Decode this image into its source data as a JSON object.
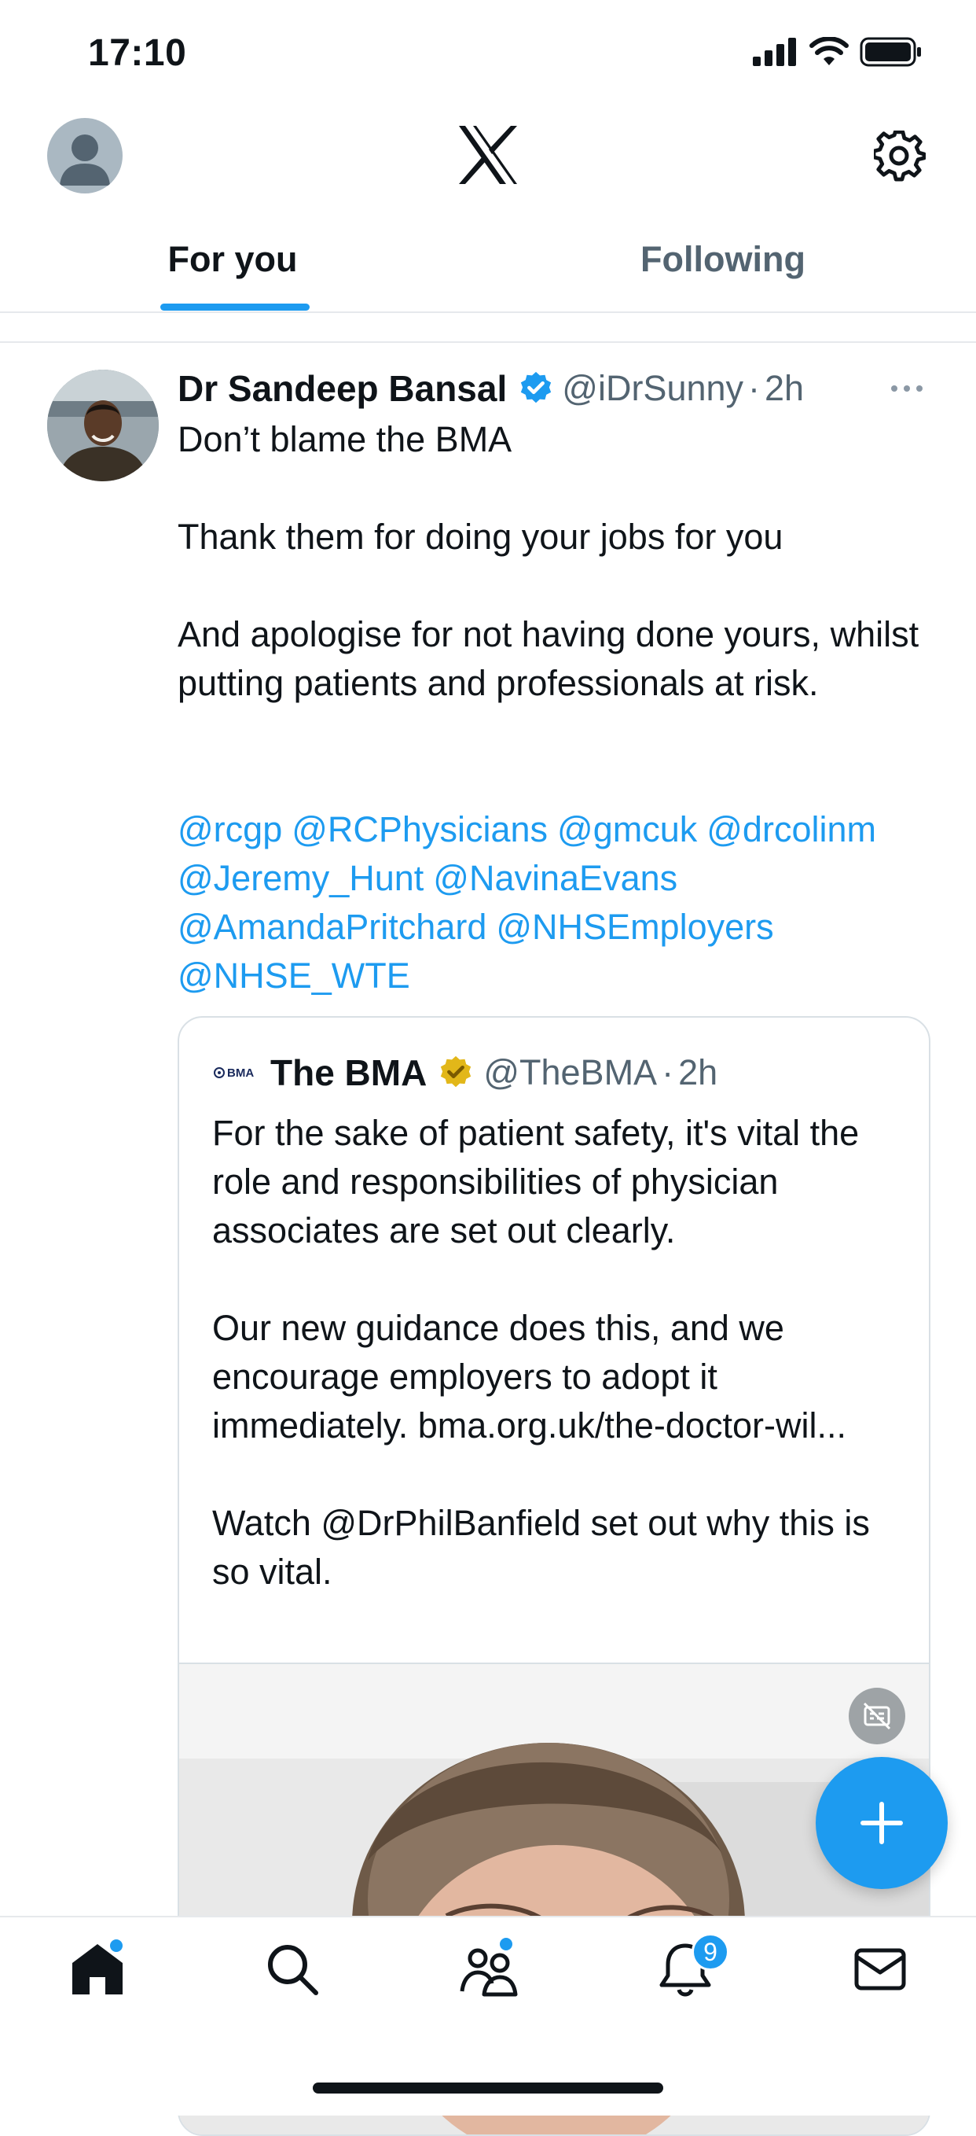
{
  "status_bar": {
    "time": "17:10"
  },
  "tabs": [
    {
      "label": "For you",
      "active": true
    },
    {
      "label": "Following",
      "active": false
    }
  ],
  "tweet": {
    "author_name": "Dr Sandeep Bansal",
    "handle": "@iDrSunny",
    "separator": "·",
    "time": "2h",
    "paragraphs": [
      "Don’t blame the BMA",
      "Thank them for doing your jobs for you",
      "And apologise for not having done yours, whilst putting patients and professionals at risk."
    ],
    "mentions": [
      "@rcgp",
      "@RCPhysicians",
      "@gmcuk",
      "@drcolinm",
      "@Jeremy_Hunt",
      "@NavinaEvans",
      "@AmandaPritchard",
      "@NHSEmployers",
      "@NHSE_WTE"
    ]
  },
  "quoted_tweet": {
    "logo_text": "BMA",
    "author_name": "The BMA",
    "handle": "@TheBMA",
    "separator": "·",
    "time": "2h",
    "paragraphs": [
      "For the sake of patient safety, it's vital the role and responsibilities of physician associates are set out clearly.",
      "Our new guidance does this, and we encourage employers to adopt it immediately. bma.org.uk/the-doctor-wil...",
      "Watch @DrPhilBanfield set out why this is so vital."
    ]
  },
  "notifications_badge": "9",
  "colors": {
    "accent": "#1d9bf0",
    "text": "#0f1419",
    "secondary": "#536471",
    "gold_badge": "#e2b719"
  },
  "icons": [
    "x-logo-icon",
    "gear-icon",
    "verified-badge-icon",
    "more-icon",
    "caption-icon",
    "plus-icon",
    "home-icon",
    "search-icon",
    "communities-icon",
    "bell-icon",
    "mail-icon"
  ]
}
